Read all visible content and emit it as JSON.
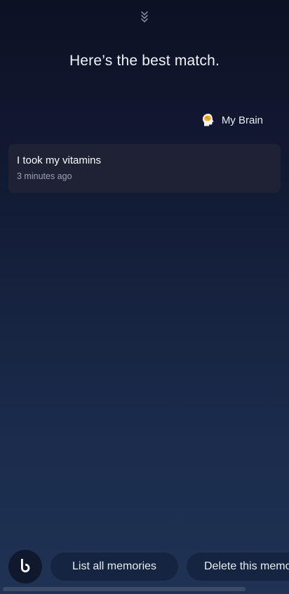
{
  "headline": "Here’s the best match.",
  "source": {
    "icon": "brain-icon",
    "label": "My Brain"
  },
  "memory": {
    "title": "I took my vitamins",
    "time": "3 minutes ago"
  },
  "bottom_bar": {
    "assistant_icon": "bixby-icon",
    "chips": [
      {
        "label": "List all memories"
      },
      {
        "label": "Delete this memory"
      }
    ]
  },
  "colors": {
    "background_top": "#0c1124",
    "background_bottom": "#1f3354",
    "card": "#1e2234",
    "chip": "#152440",
    "muted_text": "#9aa2b6"
  }
}
